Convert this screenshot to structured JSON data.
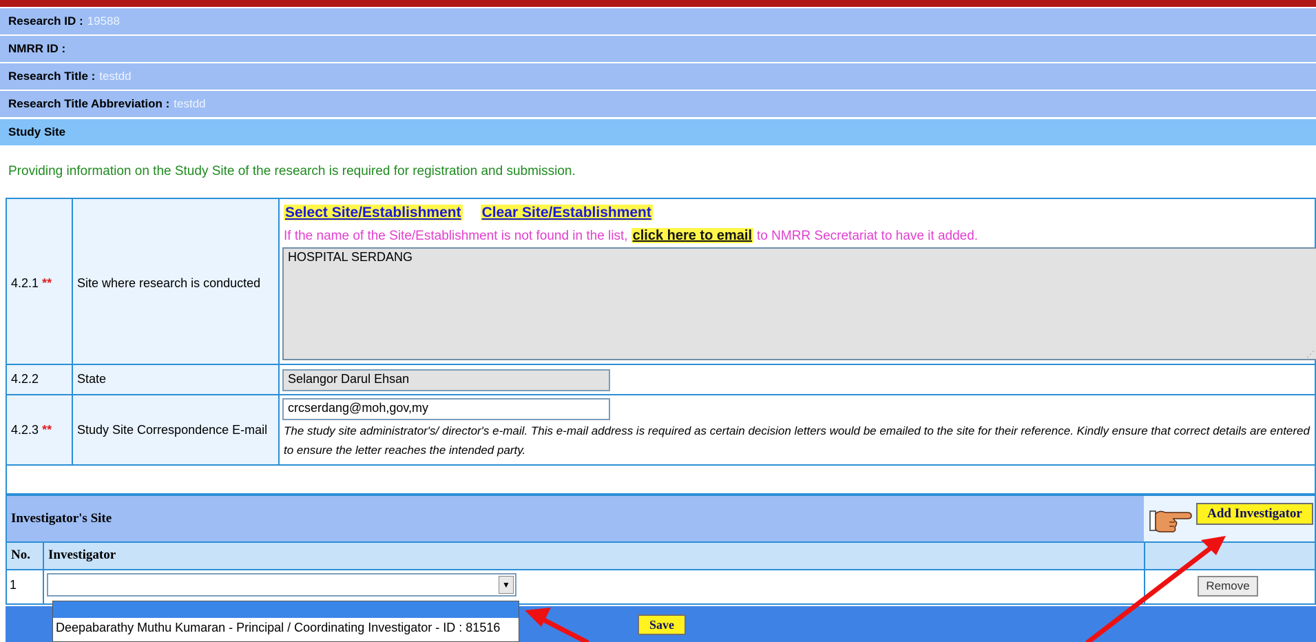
{
  "header": {
    "research_id_label": "Research ID :",
    "research_id_value": "19588",
    "nmrr_id_label": "NMRR ID :",
    "nmrr_id_value": "",
    "title_label": "Research Title :",
    "title_value": "testdd",
    "abbr_label": "Research Title Abbreviation :",
    "abbr_value": "testdd",
    "section_label": "Study Site"
  },
  "notice": "Providing information on the Study Site of the research is required for registration and submission.",
  "site": {
    "num": "4.2.1",
    "req": "**",
    "label": "Site where research is conducted",
    "select_link": "Select Site/Establishment",
    "clear_link": "Clear Site/Establishment",
    "help_prefix": "If the name of the Site/Establishment is not found in the list,",
    "help_link": "click here to email",
    "help_suffix": "to NMRR Secretariat to have it added.",
    "value": "HOSPITAL SERDANG"
  },
  "state": {
    "num": "4.2.2",
    "label": "State",
    "value": "Selangor Darul Ehsan"
  },
  "email": {
    "num": "4.2.3",
    "req": "**",
    "label": "Study Site Correspondence E-mail",
    "value": "crcserdang@moh,gov,my",
    "note": "The study site administrator's/ director's e-mail. This e-mail address is required as certain decision letters would be emailed to the site for their reference. Kindly ensure that correct details are entered to ensure the letter reaches the intended party."
  },
  "investigators": {
    "title": "Investigator's Site",
    "add_button": "Add Investigator",
    "col_no": "No.",
    "col_investigator": "Investigator",
    "rows": [
      {
        "no": "1",
        "selected": "",
        "remove_label": "Remove"
      }
    ],
    "dropdown_options": [
      "",
      "Deepabarathy Muthu Kumaran - Principal / Coordinating Investigator - ID : 81516"
    ]
  },
  "footer": {
    "save_label": "Save"
  },
  "colors": {
    "header_bg": "#9dbdf4",
    "study_site_bg": "#82c2f8",
    "link_highlight": "#fff64a",
    "footer_bg": "#3f82e6",
    "arrow": "#ee1111"
  }
}
